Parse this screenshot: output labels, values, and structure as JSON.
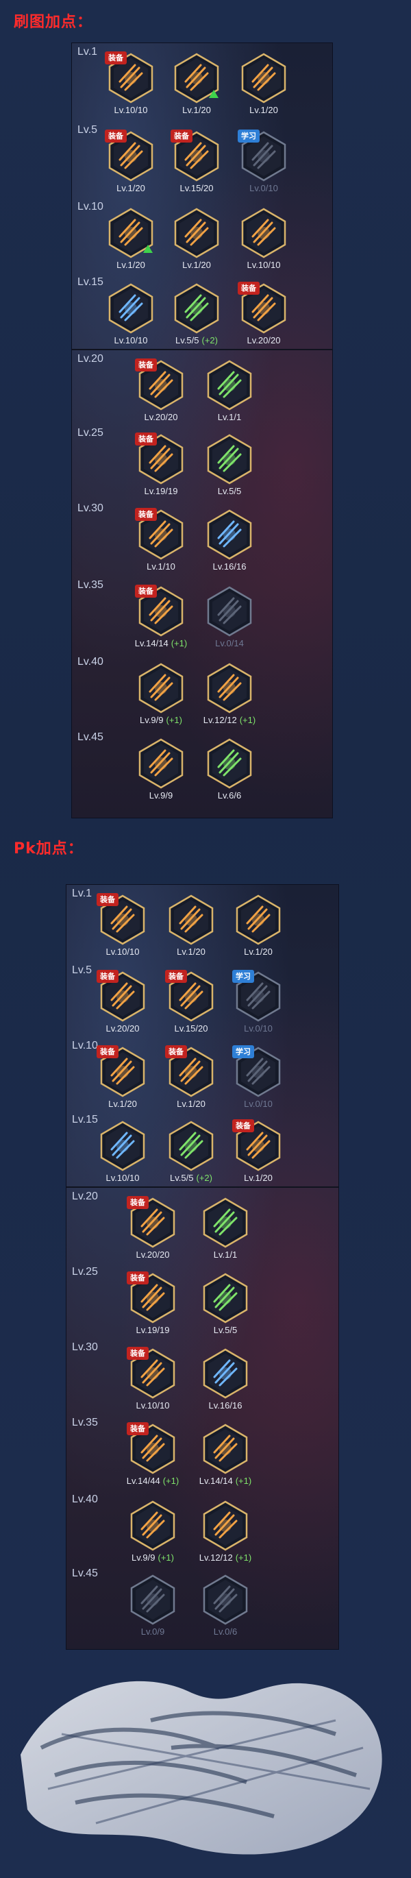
{
  "sections": [
    {
      "title": "刷图加点：",
      "rows": [
        {
          "level": "Lv.1",
          "skills": [
            {
              "badge": "装备",
              "badge_type": "equip",
              "text": "Lv.10/10",
              "bonus": "",
              "dim": false,
              "icon": "claw-slash-icon",
              "color": "#f2a244",
              "arrow": false
            },
            {
              "badge": "",
              "badge_type": "",
              "text": "Lv.1/20",
              "bonus": "",
              "dim": false,
              "icon": "triple-slash-icon",
              "color": "#f2a244",
              "arrow": true
            },
            {
              "badge": "",
              "badge_type": "",
              "text": "Lv.1/20",
              "bonus": "",
              "dim": false,
              "icon": "flame-wave-icon",
              "color": "#f2a244",
              "arrow": false
            }
          ]
        },
        {
          "level": "Lv.5",
          "skills": [
            {
              "badge": "装备",
              "badge_type": "equip",
              "text": "Lv.1/20",
              "bonus": "",
              "dim": false,
              "icon": "burst-strike-icon",
              "color": "#f2a244",
              "arrow": false
            },
            {
              "badge": "装备",
              "badge_type": "equip",
              "text": "Lv.15/20",
              "bonus": "",
              "dim": false,
              "icon": "whirl-slash-icon",
              "color": "#f2a244",
              "arrow": false
            },
            {
              "badge": "学习",
              "badge_type": "learn",
              "text": "Lv.0/10",
              "bonus": "",
              "dim": true,
              "icon": "armor-icon",
              "color": "#9fb6d8",
              "arrow": false
            }
          ]
        },
        {
          "level": "Lv.10",
          "skills": [
            {
              "badge": "",
              "badge_type": "",
              "text": "Lv.1/20",
              "bonus": "",
              "dim": false,
              "icon": "spark-burst-icon",
              "color": "#f2a244",
              "arrow": true
            },
            {
              "badge": "",
              "badge_type": "",
              "text": "Lv.1/20",
              "bonus": "",
              "dim": false,
              "icon": "crescent-slash-icon",
              "color": "#f2a244",
              "arrow": false
            },
            {
              "badge": "",
              "badge_type": "",
              "text": "Lv.10/10",
              "bonus": "",
              "dim": false,
              "icon": "beast-head-icon",
              "color": "#f2a244",
              "arrow": false
            }
          ]
        },
        {
          "level": "Lv.15",
          "skills": [
            {
              "badge": "",
              "badge_type": "",
              "text": "Lv.10/10",
              "bonus": "",
              "dim": false,
              "icon": "orb-cluster-icon",
              "color": "#6fb7ff",
              "arrow": false
            },
            {
              "badge": "",
              "badge_type": "",
              "text": "Lv.5/5",
              "bonus": "(+2)",
              "dim": false,
              "icon": "green-blade-icon",
              "color": "#7fe36a",
              "arrow": false
            },
            {
              "badge": "装备",
              "badge_type": "equip",
              "text": "Lv.20/20",
              "bonus": "",
              "dim": false,
              "icon": "arc-slash-icon",
              "color": "#f2a244",
              "arrow": false
            }
          ]
        },
        {
          "level": "Lv.20",
          "skills": [
            {
              "badge": "装备",
              "badge_type": "equip",
              "text": "Lv.20/20",
              "bonus": "",
              "dim": false,
              "icon": "twin-strike-icon",
              "color": "#f2a244",
              "arrow": false
            },
            {
              "badge": "",
              "badge_type": "",
              "text": "Lv.1/1",
              "bonus": "",
              "dim": false,
              "icon": "wind-slash-icon",
              "color": "#7fe36a",
              "arrow": false
            }
          ]
        },
        {
          "level": "Lv.25",
          "skills": [
            {
              "badge": "装备",
              "badge_type": "equip",
              "text": "Lv.19/19",
              "bonus": "",
              "dim": false,
              "icon": "flame-ring-icon",
              "color": "#f2a244",
              "arrow": false
            },
            {
              "badge": "",
              "badge_type": "",
              "text": "Lv.5/5",
              "bonus": "",
              "dim": false,
              "icon": "warrior-pose-icon",
              "color": "#7fe36a",
              "arrow": false
            }
          ]
        },
        {
          "level": "Lv.30",
          "skills": [
            {
              "badge": "装备",
              "badge_type": "equip",
              "text": "Lv.1/10",
              "bonus": "",
              "dim": false,
              "icon": "skull-icon",
              "color": "#f2a244",
              "arrow": false
            },
            {
              "badge": "",
              "badge_type": "",
              "text": "Lv.16/16",
              "bonus": "",
              "dim": false,
              "icon": "aura-body-icon",
              "color": "#6fb7ff",
              "arrow": false
            }
          ]
        },
        {
          "level": "Lv.35",
          "skills": [
            {
              "badge": "装备",
              "badge_type": "equip",
              "text": "Lv.14/14",
              "bonus": "(+1)",
              "dim": false,
              "icon": "storm-strike-icon",
              "color": "#f2a244",
              "arrow": false
            },
            {
              "badge": "",
              "badge_type": "",
              "text": "Lv.0/14",
              "bonus": "",
              "dim": true,
              "icon": "vortex-icon",
              "color": "#9fb6d8",
              "arrow": false
            }
          ]
        },
        {
          "level": "Lv.40",
          "skills": [
            {
              "badge": "",
              "badge_type": "",
              "text": "Lv.9/9",
              "bonus": "(+1)",
              "dim": false,
              "icon": "radiant-figure-icon",
              "color": "#f2a244",
              "arrow": false
            },
            {
              "badge": "",
              "badge_type": "",
              "text": "Lv.12/12",
              "bonus": "(+1)",
              "dim": false,
              "icon": "spiral-blade-icon",
              "color": "#f2a244",
              "arrow": false
            }
          ]
        },
        {
          "level": "Lv.45",
          "skills": [
            {
              "badge": "",
              "badge_type": "",
              "text": "Lv.9/9",
              "bonus": "",
              "dim": false,
              "icon": "multi-arm-icon",
              "color": "#f2a244",
              "arrow": false
            },
            {
              "badge": "",
              "badge_type": "",
              "text": "Lv.6/6",
              "bonus": "",
              "dim": false,
              "icon": "green-giant-icon",
              "color": "#7fe36a",
              "arrow": false
            }
          ]
        }
      ]
    },
    {
      "title": "Pk加点：",
      "rows": [
        {
          "level": "Lv.1",
          "skills": [
            {
              "badge": "装备",
              "badge_type": "equip",
              "text": "Lv.10/10",
              "bonus": "",
              "dim": false,
              "icon": "claw-slash-icon",
              "color": "#f2a244",
              "arrow": false
            },
            {
              "badge": "",
              "badge_type": "",
              "text": "Lv.1/20",
              "bonus": "",
              "dim": false,
              "icon": "triple-slash-icon",
              "color": "#f2a244",
              "arrow": false
            },
            {
              "badge": "",
              "badge_type": "",
              "text": "Lv.1/20",
              "bonus": "",
              "dim": false,
              "icon": "flame-wave-icon",
              "color": "#f2a244",
              "arrow": false
            }
          ]
        },
        {
          "level": "Lv.5",
          "skills": [
            {
              "badge": "装备",
              "badge_type": "equip",
              "text": "Lv.20/20",
              "bonus": "",
              "dim": false,
              "icon": "burst-strike-icon",
              "color": "#f2a244",
              "arrow": false
            },
            {
              "badge": "装备",
              "badge_type": "equip",
              "text": "Lv.15/20",
              "bonus": "",
              "dim": false,
              "icon": "whirl-slash-icon",
              "color": "#f2a244",
              "arrow": false
            },
            {
              "badge": "学习",
              "badge_type": "learn",
              "text": "Lv.0/10",
              "bonus": "",
              "dim": true,
              "icon": "armor-icon",
              "color": "#9fb6d8",
              "arrow": false
            }
          ]
        },
        {
          "level": "Lv.10",
          "skills": [
            {
              "badge": "装备",
              "badge_type": "equip",
              "text": "Lv.1/20",
              "bonus": "",
              "dim": false,
              "icon": "spark-burst-icon",
              "color": "#f2a244",
              "arrow": false
            },
            {
              "badge": "装备",
              "badge_type": "equip",
              "text": "Lv.1/20",
              "bonus": "",
              "dim": false,
              "icon": "crescent-slash-icon",
              "color": "#f2a244",
              "arrow": false
            },
            {
              "badge": "学习",
              "badge_type": "learn",
              "text": "Lv.0/10",
              "bonus": "",
              "dim": true,
              "icon": "beast-head-icon",
              "color": "#9fb6d8",
              "arrow": false
            }
          ]
        },
        {
          "level": "Lv.15",
          "skills": [
            {
              "badge": "",
              "badge_type": "",
              "text": "Lv.10/10",
              "bonus": "",
              "dim": false,
              "icon": "orb-cluster-icon",
              "color": "#6fb7ff",
              "arrow": false
            },
            {
              "badge": "",
              "badge_type": "",
              "text": "Lv.5/5",
              "bonus": "(+2)",
              "dim": false,
              "icon": "green-blade-icon",
              "color": "#7fe36a",
              "arrow": false
            },
            {
              "badge": "装备",
              "badge_type": "equip",
              "text": "Lv.1/20",
              "bonus": "",
              "dim": false,
              "icon": "arc-slash-icon",
              "color": "#f2a244",
              "arrow": false
            }
          ]
        },
        {
          "level": "Lv.20",
          "skills": [
            {
              "badge": "装备",
              "badge_type": "equip",
              "text": "Lv.20/20",
              "bonus": "",
              "dim": false,
              "icon": "twin-strike-icon",
              "color": "#f2a244",
              "arrow": false
            },
            {
              "badge": "",
              "badge_type": "",
              "text": "Lv.1/1",
              "bonus": "",
              "dim": false,
              "icon": "wind-slash-icon",
              "color": "#7fe36a",
              "arrow": false
            }
          ]
        },
        {
          "level": "Lv.25",
          "skills": [
            {
              "badge": "装备",
              "badge_type": "equip",
              "text": "Lv.19/19",
              "bonus": "",
              "dim": false,
              "icon": "flame-ring-icon",
              "color": "#f2a244",
              "arrow": false
            },
            {
              "badge": "",
              "badge_type": "",
              "text": "Lv.5/5",
              "bonus": "",
              "dim": false,
              "icon": "warrior-pose-icon",
              "color": "#7fe36a",
              "arrow": false
            }
          ]
        },
        {
          "level": "Lv.30",
          "skills": [
            {
              "badge": "装备",
              "badge_type": "equip",
              "text": "Lv.10/10",
              "bonus": "",
              "dim": false,
              "icon": "skull-icon",
              "color": "#f2a244",
              "arrow": false
            },
            {
              "badge": "",
              "badge_type": "",
              "text": "Lv.16/16",
              "bonus": "",
              "dim": false,
              "icon": "aura-body-icon",
              "color": "#6fb7ff",
              "arrow": false
            }
          ]
        },
        {
          "level": "Lv.35",
          "skills": [
            {
              "badge": "装备",
              "badge_type": "equip",
              "text": "Lv.14/44",
              "bonus": "(+1)",
              "dim": false,
              "icon": "storm-strike-icon",
              "color": "#f2a244",
              "arrow": false
            },
            {
              "badge": "",
              "badge_type": "",
              "text": "Lv.14/14",
              "bonus": "(+1)",
              "dim": false,
              "icon": "vortex-icon",
              "color": "#f2a244",
              "arrow": false
            }
          ]
        },
        {
          "level": "Lv.40",
          "skills": [
            {
              "badge": "",
              "badge_type": "",
              "text": "Lv.9/9",
              "bonus": "(+1)",
              "dim": false,
              "icon": "radiant-figure-icon",
              "color": "#f2a244",
              "arrow": false
            },
            {
              "badge": "",
              "badge_type": "",
              "text": "Lv.12/12",
              "bonus": "(+1)",
              "dim": false,
              "icon": "spiral-blade-icon",
              "color": "#f2a244",
              "arrow": false
            }
          ]
        },
        {
          "level": "Lv.45",
          "skills": [
            {
              "badge": "",
              "badge_type": "",
              "text": "Lv.0/9",
              "bonus": "",
              "dim": true,
              "icon": "multi-arm-icon",
              "color": "#9fb6d8",
              "arrow": false
            },
            {
              "badge": "",
              "badge_type": "",
              "text": "Lv.0/6",
              "bonus": "",
              "dim": true,
              "icon": "green-giant-icon",
              "color": "#9fb6d8",
              "arrow": false
            }
          ]
        }
      ]
    }
  ]
}
